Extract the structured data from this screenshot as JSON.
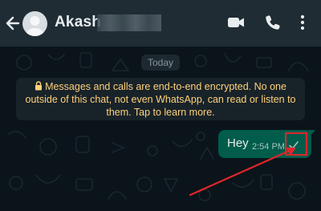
{
  "header": {
    "contact_name": "Akash",
    "icons": [
      "back-arrow-icon",
      "avatar",
      "video-call-icon",
      "voice-call-icon",
      "more-options-icon"
    ]
  },
  "chat": {
    "date_label": "Today",
    "encryption_notice": "Messages and calls are end-to-end encrypted. No one outside of this chat, not even WhatsApp, can read or listen to them. Tap to learn more.",
    "messages": [
      {
        "text": "Hey",
        "time": "2:54 PM",
        "status": "sent",
        "status_icon": "single-check-icon"
      }
    ]
  },
  "annotation": {
    "color": "#e0262c"
  },
  "colors": {
    "header_bg": "#1f2c34",
    "chat_bg": "#0b141a",
    "outgoing_bubble": "#005c4b",
    "notice_text": "#ffd279"
  }
}
